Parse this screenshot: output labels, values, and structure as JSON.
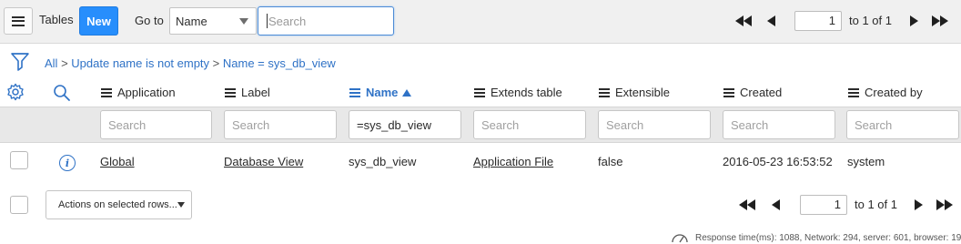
{
  "toolbar": {
    "tables_label": "Tables",
    "new_label": "New",
    "goto_label": "Go to",
    "goto_selected": "Name",
    "search_placeholder": "Search"
  },
  "pager_top": {
    "page": "1",
    "of_text": "to 1 of 1"
  },
  "breadcrumb": {
    "all": "All",
    "sep": ">",
    "crumb1": "Update name is not empty",
    "crumb2": "Name = sys_db_view"
  },
  "columns": [
    {
      "label": "Application",
      "search": "Search"
    },
    {
      "label": "Label",
      "search": "Search"
    },
    {
      "label": "Name",
      "search": "=sys_db_view"
    },
    {
      "label": "Extends table",
      "search": "Search"
    },
    {
      "label": "Extensible",
      "search": "Search"
    },
    {
      "label": "Created",
      "search": "Search"
    },
    {
      "label": "Created by",
      "search": "Search"
    }
  ],
  "row": {
    "application": "Global",
    "label": "Database View",
    "name": "sys_db_view",
    "extends_table": "Application File",
    "extensible": "false",
    "created": "2016-05-23 16:53:52",
    "created_by": "system"
  },
  "footer": {
    "actions_label": "Actions on selected rows...",
    "page": "1",
    "of_text": "to 1 of 1",
    "response_text": "Response time(ms): 1088, Network: 294, server: 601, browser: 19"
  },
  "colors": {
    "accent": "#278efc",
    "link": "#2f72c6"
  }
}
